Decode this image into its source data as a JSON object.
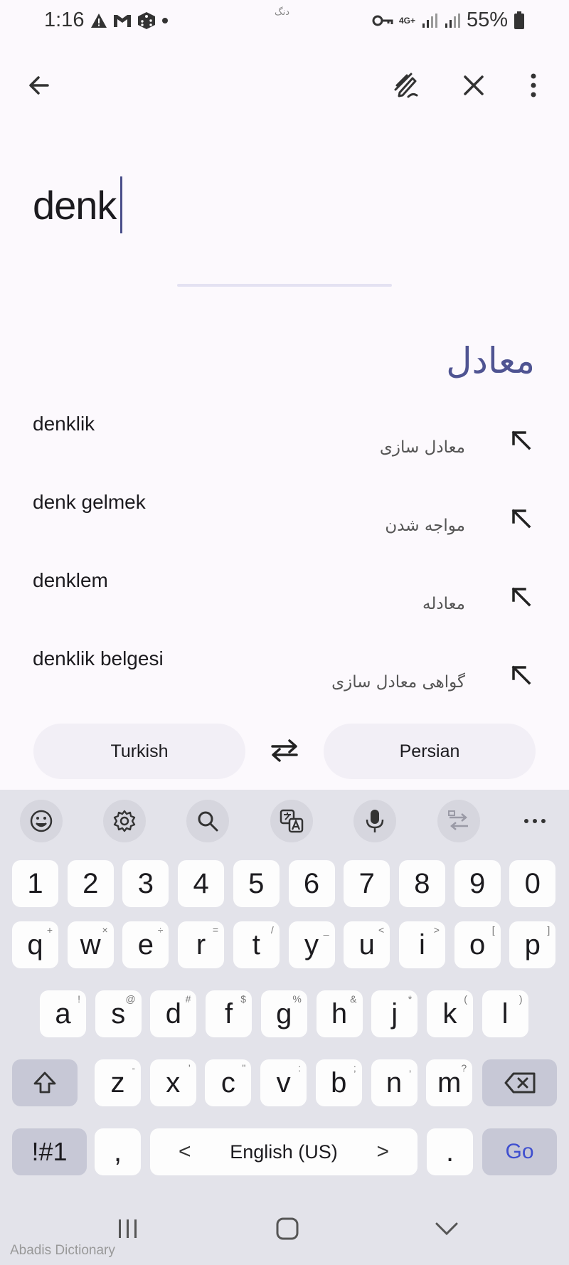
{
  "status_bar": {
    "time": "1:16",
    "center_text": "دنگ",
    "battery": "55%",
    "network": "4G+"
  },
  "app_bar": {
    "back_icon": "arrow-left-icon",
    "handwriting_icon": "handwriting-icon",
    "clear_icon": "close-icon",
    "menu_icon": "more-vert-icon"
  },
  "search": {
    "value": "denk"
  },
  "section": {
    "title": "معادل"
  },
  "results": [
    {
      "word": "denklik",
      "meaning": "معادل سازی"
    },
    {
      "word": "denk gelmek",
      "meaning": "مواجه شدن"
    },
    {
      "word": "denklem",
      "meaning": "معادله"
    },
    {
      "word": "denklik belgesi",
      "meaning": "گواهی معادل سازی"
    }
  ],
  "languages": {
    "source": "Turkish",
    "target": "Persian"
  },
  "keyboard": {
    "toolbar": [
      "emoji-icon",
      "settings-icon",
      "search-icon",
      "translate-icon",
      "mic-icon",
      "convert-icon",
      "more-horiz-icon"
    ],
    "number_row": [
      "1",
      "2",
      "3",
      "4",
      "5",
      "6",
      "7",
      "8",
      "9",
      "0"
    ],
    "row1": [
      {
        "k": "q",
        "s": "+"
      },
      {
        "k": "w",
        "s": "×"
      },
      {
        "k": "e",
        "s": "÷"
      },
      {
        "k": "r",
        "s": "="
      },
      {
        "k": "t",
        "s": "/"
      },
      {
        "k": "y",
        "s": "_"
      },
      {
        "k": "u",
        "s": "<"
      },
      {
        "k": "i",
        "s": ">"
      },
      {
        "k": "o",
        "s": "["
      },
      {
        "k": "p",
        "s": "]"
      }
    ],
    "row2": [
      {
        "k": "a",
        "s": "!"
      },
      {
        "k": "s",
        "s": "@"
      },
      {
        "k": "d",
        "s": "#"
      },
      {
        "k": "f",
        "s": "$"
      },
      {
        "k": "g",
        "s": "%"
      },
      {
        "k": "h",
        "s": "&"
      },
      {
        "k": "j",
        "s": "*"
      },
      {
        "k": "k",
        "s": "("
      },
      {
        "k": "l",
        "s": ")"
      }
    ],
    "row3": [
      {
        "k": "z",
        "s": "-"
      },
      {
        "k": "x",
        "s": "'"
      },
      {
        "k": "c",
        "s": "\""
      },
      {
        "k": "v",
        "s": ":"
      },
      {
        "k": "b",
        "s": ";"
      },
      {
        "k": "n",
        "s": ","
      },
      {
        "k": "m",
        "s": "?"
      }
    ],
    "symbols_label": "!#1",
    "comma_label": ",",
    "space_label": "English (US)",
    "space_left": "<",
    "space_right": ">",
    "period_label": ".",
    "go_label": "Go"
  },
  "watermark": "Abadis Dictionary"
}
